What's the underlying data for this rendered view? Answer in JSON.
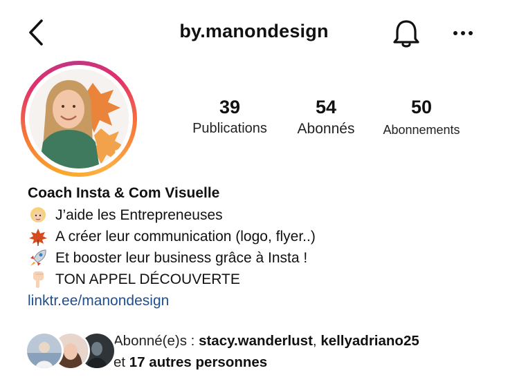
{
  "header": {
    "username": "by.manondesign",
    "icons": [
      "back-arrow-icon",
      "bell-icon",
      "more-options-icon"
    ]
  },
  "stats": [
    {
      "value": "39",
      "label": "Publications"
    },
    {
      "value": "54",
      "label": "Abonnés"
    },
    {
      "value": "50",
      "label": "Abonnements"
    }
  ],
  "bio": {
    "name": "Coach Insta & Com Visuelle",
    "lines": [
      {
        "emoji": "woman-emoji",
        "text": "J’aide les Entrepreneuses"
      },
      {
        "emoji": "maple-leaf-emoji",
        "text": "A créer leur communication (logo, flyer..)"
      },
      {
        "emoji": "rocket-emoji",
        "text": "Et booster leur business grâce à Insta !"
      },
      {
        "emoji": "pointing-down-emoji",
        "text": "TON APPEL DÉCOUVERTE"
      }
    ],
    "link": "linktr.ee/manondesign"
  },
  "followers": {
    "prefix": "Abonné(e)s : ",
    "name1": "stacy.wanderlust",
    "separator": ", ",
    "name2": "kellyadriano25",
    "and": "et ",
    "others": "17 autres personnes"
  },
  "colors": {
    "text": "#111111",
    "link": "#1f4e8c",
    "ring_start": "#f9a72b",
    "ring_end": "#c13584"
  }
}
